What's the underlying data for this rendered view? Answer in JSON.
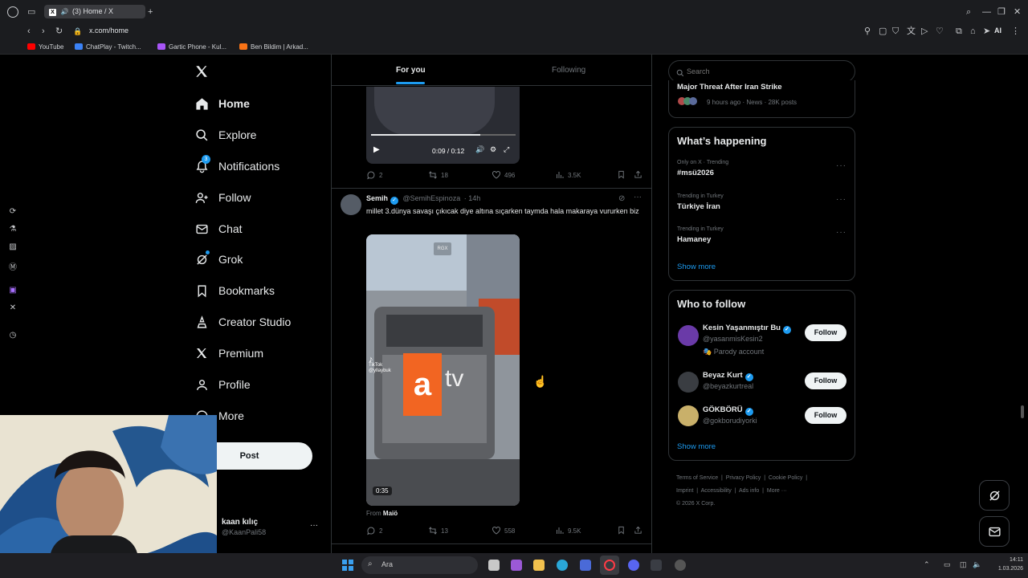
{
  "browser": {
    "tab_title": "(3) Home / X",
    "url": "x.com/home",
    "bookmarks": [
      {
        "label": "YouTube",
        "color": "#ff0000"
      },
      {
        "label": "ChatPlay - Twitch...",
        "color": "#3b82f6"
      },
      {
        "label": "Gartic Phone - Kul...",
        "color": "#a855f7"
      },
      {
        "label": "Ben Bildim | Arkad...",
        "color": "#f97316"
      }
    ],
    "ai_label": "AI"
  },
  "nav": {
    "items": [
      {
        "label": "Home",
        "icon": "home-icon"
      },
      {
        "label": "Explore",
        "icon": "search-icon"
      },
      {
        "label": "Notifications",
        "icon": "bell-icon",
        "badge": "3"
      },
      {
        "label": "Follow",
        "icon": "person-add-icon"
      },
      {
        "label": "Chat",
        "icon": "mail-icon"
      },
      {
        "label": "Grok",
        "icon": "grok-icon"
      },
      {
        "label": "Bookmarks",
        "icon": "bookmark-icon"
      },
      {
        "label": "Creator Studio",
        "icon": "creator-studio-icon"
      },
      {
        "label": "Premium",
        "icon": "x-icon"
      },
      {
        "label": "Profile",
        "icon": "profile-icon"
      },
      {
        "label": "More",
        "icon": "more-icon"
      }
    ],
    "post_button": "Post",
    "account": {
      "name": "kaan kılıç",
      "handle": "@KaanPali58"
    }
  },
  "feed": {
    "tabs": {
      "for_you": "For you",
      "following": "Following"
    },
    "post1": {
      "video_time": "0:09 / 0:12",
      "replies": "2",
      "reposts": "18",
      "likes": "496",
      "views": "3.5K"
    },
    "post2": {
      "author": "Semih",
      "handle": "@SemihEspinoza",
      "time": "· 14h",
      "text": "millet 3.dünya savaşı çıkıcak diye altına sıçarken taymda hala makaraya vururken biz",
      "video_overlay": "RGX",
      "tiktok_label": "TikTok",
      "tiktok_handle": "@yllaybuk",
      "video_brand_a": "a",
      "video_brand_tv": "tv",
      "duration": "0:35",
      "from_prefix": "From",
      "from_user": "Maiö",
      "replies": "2",
      "reposts": "13",
      "likes": "558",
      "views": "9.5K"
    }
  },
  "right": {
    "search_placeholder": "Search",
    "top_trend": {
      "title": "Major Threat After Iran Strike",
      "meta": "9 hours ago · News · 28K posts"
    },
    "happening": {
      "title": "What’s happening",
      "trends": [
        {
          "context": "Only on X · Trending",
          "name": "#msü2026"
        },
        {
          "context": "Trending in Turkey",
          "name": "Türkiye İran"
        },
        {
          "context": "Trending in Turkey",
          "name": "Hamaney"
        }
      ],
      "show_more": "Show more"
    },
    "who_to_follow": {
      "title": "Who to follow",
      "users": [
        {
          "name": "Kesin Yaşanmıştır Bu",
          "handle": "@yasanmisKesin2",
          "extra": "Parody account"
        },
        {
          "name": "Beyaz Kurt",
          "handle": "@beyazkurtreal",
          "extra": ""
        },
        {
          "name": "GÖKBÖRÜ",
          "handle": "@gokborudiyorki",
          "extra": ""
        }
      ],
      "follow_label": "Follow",
      "show_more": "Show more"
    },
    "footer": {
      "links": [
        "Terms of Service",
        "Privacy Policy",
        "Cookie Policy",
        "Imprint",
        "Accessibility",
        "Ads info",
        "More ···"
      ],
      "copyright": "© 2026 X Corp."
    }
  },
  "taskbar": {
    "search_label": "Ara",
    "time": "14:11",
    "date": "1.03.2026"
  }
}
